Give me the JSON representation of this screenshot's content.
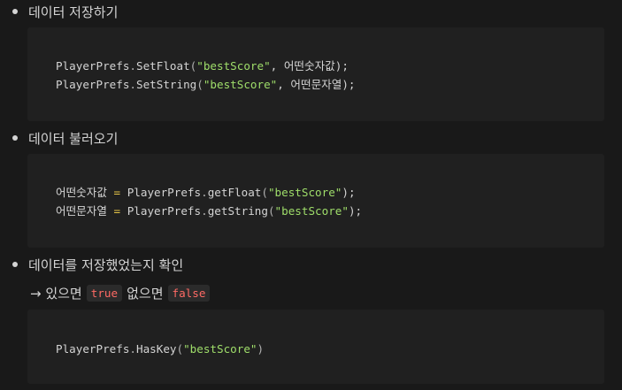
{
  "sections": [
    {
      "heading": "데이터 저장하기",
      "code": [
        [
          "PlayerPrefs",
          ".",
          "SetFloat",
          "(",
          "\"bestScore\"",
          ", 어떤숫자값);"
        ],
        [
          "PlayerPrefs",
          ".",
          "SetString",
          "(",
          "\"bestScore\"",
          ", 어떤문자열);"
        ]
      ]
    },
    {
      "heading": "데이터 불러오기",
      "code": [
        [
          "어떤숫자값 ",
          "=",
          " PlayerPrefs",
          ".",
          "getFloat",
          "(",
          "\"bestScore\"",
          ");"
        ],
        [
          "어떤문자열 ",
          "=",
          " PlayerPrefs",
          ".",
          "getString",
          "(",
          "\"bestScore\"",
          ");"
        ]
      ]
    },
    {
      "heading": "데이터를 저장했었는지 확인",
      "note": {
        "prefix": "→ 있으면",
        "true_code": "true",
        "middle": "없으면",
        "false_code": "false"
      },
      "code": [
        [
          "PlayerPrefs",
          ".",
          "HasKey",
          "(",
          "\"bestScore\"",
          ")"
        ]
      ]
    }
  ]
}
